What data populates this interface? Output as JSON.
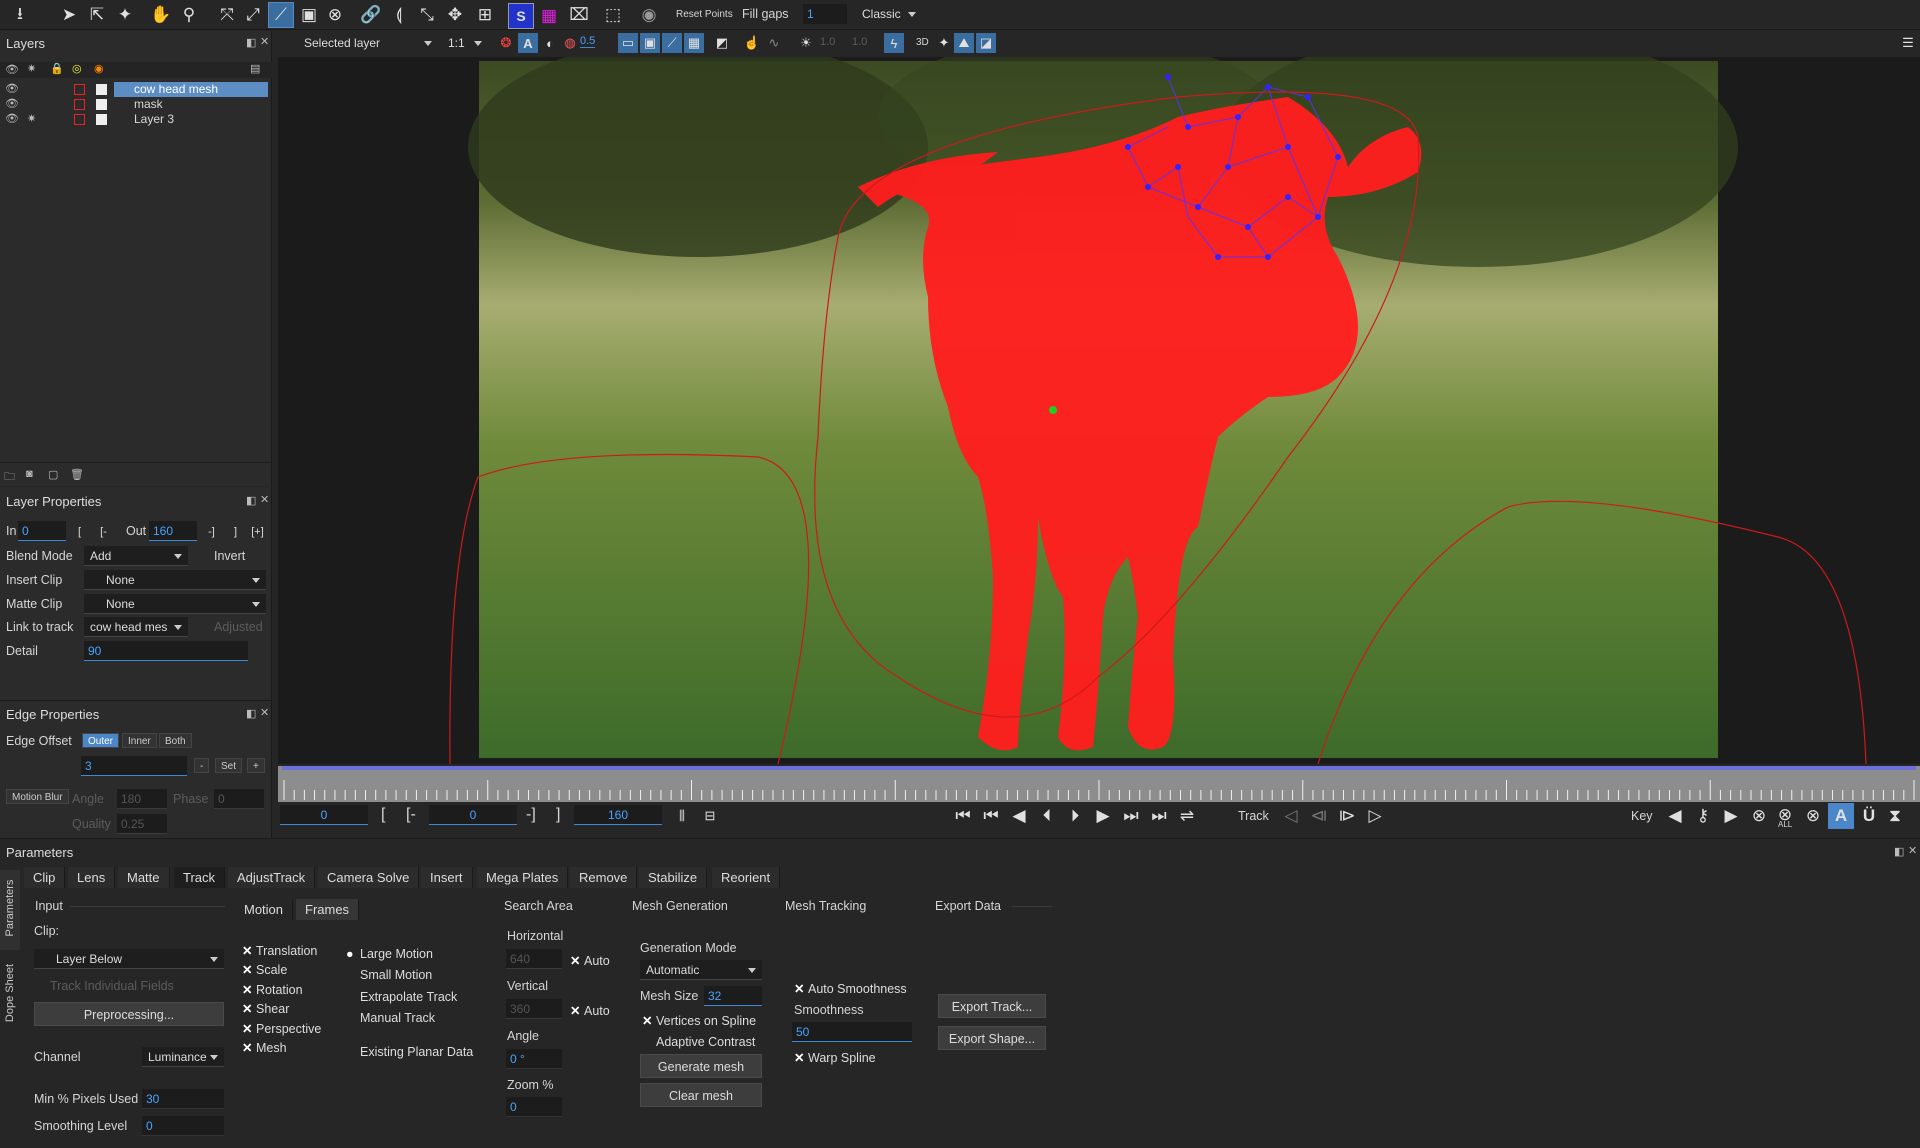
{
  "toolbar": {
    "reset_points": "Reset Points",
    "fill_gaps": "Fill gaps",
    "fill_gaps_value": "1",
    "mode": "Classic",
    "selected_layer": "Selected layer",
    "zoom": "1:1",
    "opacity": "0.5",
    "brightness_a": "1.0",
    "brightness_b": "1.0",
    "three_d": "3D"
  },
  "layers": {
    "title": "Layers",
    "items": [
      {
        "name": "cow head mesh",
        "selected": true
      },
      {
        "name": "mask",
        "selected": false
      },
      {
        "name": "Layer 3",
        "selected": false
      }
    ]
  },
  "layer_properties": {
    "title": "Layer Properties",
    "in_label": "In",
    "in_value": "0",
    "out_label": "Out",
    "out_value": "160",
    "blend_mode_label": "Blend Mode",
    "blend_mode": "Add",
    "invert": "Invert",
    "insert_clip_label": "Insert Clip",
    "insert_clip": "None",
    "matte_clip_label": "Matte Clip",
    "matte_clip": "None",
    "link_to_track_label": "Link to track",
    "link_to_track": "cow head mes",
    "adjusted": "Adjusted",
    "detail_label": "Detail",
    "detail": "90"
  },
  "edge_properties": {
    "title": "Edge Properties",
    "edge_offset_label": "Edge Offset",
    "outer": "Outer",
    "inner": "Inner",
    "both": "Both",
    "offset_value": "3",
    "minus": "-",
    "set": "Set",
    "plus": "+",
    "motion_blur": "Motion Blur",
    "angle_label": "Angle",
    "angle": "180",
    "phase_label": "Phase",
    "phase": "0",
    "quality_label": "Quality",
    "quality": "0.25"
  },
  "timeline": {
    "start": "0",
    "in": "0",
    "end": "160",
    "track_label": "Track",
    "key_label": "Key",
    "all_label": "ALL"
  },
  "parameters": {
    "title": "Parameters",
    "side_tabs": [
      "Parameters",
      "Dope Sheet"
    ],
    "tabs": [
      "Clip",
      "Lens",
      "Matte",
      "Track",
      "AdjustTrack",
      "Camera Solve",
      "Insert",
      "Mega Plates",
      "Remove",
      "Stabilize",
      "Reorient"
    ],
    "active_tab": "Track",
    "input": {
      "header": "Input",
      "clip_label": "Clip:",
      "clip": "Layer Below",
      "track_individual_fields": "Track Individual Fields",
      "preprocessing": "Preprocessing...",
      "channel_label": "Channel",
      "channel": "Luminance",
      "min_pixels_label": "Min % Pixels Used",
      "min_pixels": "30",
      "smoothing_label": "Smoothing Level",
      "smoothing": "0"
    },
    "motion_tabs": [
      "Motion",
      "Frames"
    ],
    "motion_checks": [
      "Translation",
      "Scale",
      "Rotation",
      "Shear",
      "Perspective",
      "Mesh"
    ],
    "motion_radios": [
      "Large Motion",
      "Small Motion",
      "Extrapolate Track",
      "Manual Track"
    ],
    "existing_planar": "Existing Planar Data",
    "search_area": {
      "header": "Search Area",
      "horizontal_label": "Horizontal",
      "horizontal": "640",
      "vertical_label": "Vertical",
      "vertical": "360",
      "auto": "Auto",
      "angle_label": "Angle",
      "angle": "0 °",
      "zoom_label": "Zoom %",
      "zoom": "0"
    },
    "mesh_generation": {
      "header": "Mesh Generation",
      "mode_label": "Generation Mode",
      "mode": "Automatic",
      "mesh_size_label": "Mesh Size",
      "mesh_size": "32",
      "vertices_on_spline": "Vertices on Spline",
      "adaptive_contrast": "Adaptive Contrast",
      "generate": "Generate mesh",
      "clear": "Clear mesh"
    },
    "mesh_tracking": {
      "header": "Mesh Tracking",
      "auto_smoothness": "Auto Smoothness",
      "smoothness_label": "Smoothness",
      "smoothness": "50",
      "warp_spline": "Warp Spline"
    },
    "export_data": {
      "header": "Export Data",
      "export_track": "Export Track...",
      "export_shape": "Export Shape..."
    }
  },
  "colors": {
    "accent": "#4a86c8",
    "mask": "#ff1e1e",
    "timeline_bar": "#6f6fd8"
  }
}
